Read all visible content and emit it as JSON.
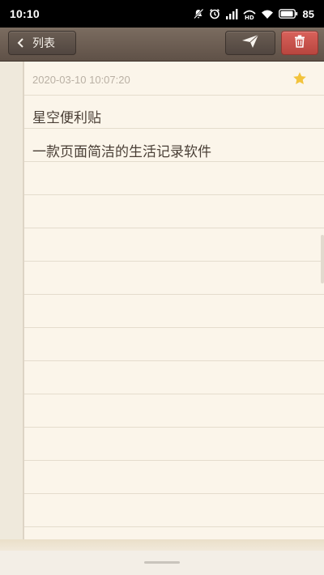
{
  "status_bar": {
    "time": "10:10",
    "battery": "85",
    "icons": [
      "mute-icon",
      "alarm-icon",
      "signal-icon",
      "hd-icon",
      "wifi-icon",
      "battery-icon"
    ]
  },
  "toolbar": {
    "back_label": "列表",
    "back_icon": "chevron-left-icon",
    "send_icon": "send-icon",
    "delete_icon": "trash-icon",
    "delete_color": "#d65a53"
  },
  "note": {
    "date": "2020-03-10 10:07:20",
    "starred": true,
    "star_color": "#f2c33c",
    "lines": [
      "星空便利贴",
      "一款页面简洁的生活记录软件"
    ]
  }
}
